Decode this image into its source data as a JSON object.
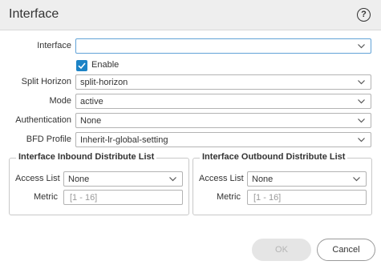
{
  "dialog": {
    "title": "Interface",
    "help_glyph": "?"
  },
  "form": {
    "interface": {
      "label": "Interface",
      "value": ""
    },
    "enable": {
      "label": "Enable",
      "checked": true
    },
    "split_horizon": {
      "label": "Split Horizon",
      "value": "split-horizon"
    },
    "mode": {
      "label": "Mode",
      "value": "active"
    },
    "authentication": {
      "label": "Authentication",
      "value": "None"
    },
    "bfd_profile": {
      "label": "BFD Profile",
      "value": "Inherit-lr-global-setting"
    }
  },
  "inbound": {
    "title": "Interface Inbound Distribute List",
    "access_list": {
      "label": "Access List",
      "value": "None"
    },
    "metric": {
      "label": "Metric",
      "placeholder": "[1 - 16]"
    }
  },
  "outbound": {
    "title": "Interface Outbound Distribute List",
    "access_list": {
      "label": "Access List",
      "value": "None"
    },
    "metric": {
      "label": "Metric",
      "placeholder": "[1 - 16]"
    }
  },
  "buttons": {
    "ok": "OK",
    "cancel": "Cancel"
  },
  "colors": {
    "accent": "#1c83c6",
    "focus_border": "#62a3d7",
    "header_bg": "#eeeeee"
  }
}
